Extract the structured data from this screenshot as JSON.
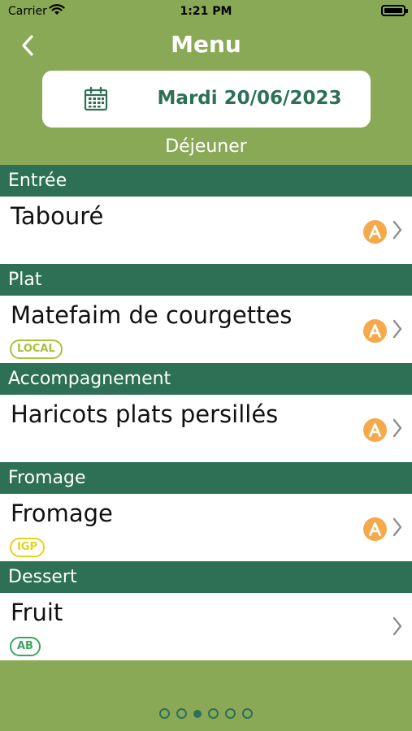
{
  "status_bar": {
    "carrier": "Carrier",
    "time": "1:21 PM"
  },
  "nav": {
    "title": "Menu"
  },
  "date_selector": {
    "date": "Mardi  20/06/2023"
  },
  "meal": "Déjeuner",
  "sections": [
    {
      "category": "Entrée",
      "dish": "Tabouré",
      "badge": null,
      "score": true
    },
    {
      "category": "Plat",
      "dish": "Matefaim de courgettes",
      "badge": "LOCAL",
      "score": true
    },
    {
      "category": "Accompagnement",
      "dish": "Haricots plats persillés",
      "badge": null,
      "score": true
    },
    {
      "category": "Fromage",
      "dish": "Fromage",
      "badge": "IGP",
      "score": true
    },
    {
      "category": "Dessert",
      "dish": "Fruit",
      "badge": "AB",
      "score": false
    }
  ],
  "badge_colors": {
    "LOCAL": "#a7c43b",
    "IGP": "#e5d21c",
    "AB": "#3ea45d"
  },
  "colors": {
    "primary": "#2d7055",
    "background": "#89a957",
    "score": "#f5a94b"
  },
  "pager": {
    "count": 6,
    "active_index": 2
  }
}
